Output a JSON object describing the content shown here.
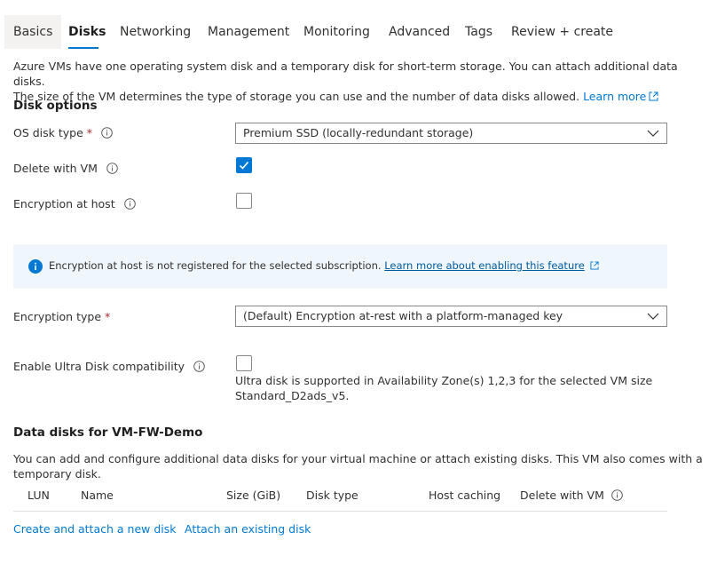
{
  "tabs": [
    {
      "label": "Basics"
    },
    {
      "label": "Disks"
    },
    {
      "label": "Networking"
    },
    {
      "label": "Management"
    },
    {
      "label": "Monitoring"
    },
    {
      "label": "Advanced"
    },
    {
      "label": "Tags"
    },
    {
      "label": "Review + create"
    }
  ],
  "active_tab": "Disks",
  "intro": {
    "line1": "Azure VMs have one operating system disk and a temporary disk for short-term storage. You can attach additional data disks.",
    "line2": "The size of the VM determines the type of storage you can use and the number of data disks allowed.",
    "learn_more": "Learn more"
  },
  "disk_options": {
    "title": "Disk options",
    "os_disk_type": {
      "label": "OS disk type",
      "required_mark": "*",
      "value": "Premium SSD (locally-redundant storage)"
    },
    "delete_with_vm": {
      "label": "Delete with VM",
      "checked": true
    },
    "encryption_at_host": {
      "label": "Encryption at host",
      "checked": false
    }
  },
  "banner": {
    "text": "Encryption at host is not registered for the selected subscription.",
    "link": "Learn more about enabling this feature"
  },
  "encryption_type": {
    "label": "Encryption type",
    "required_mark": "*",
    "value": "(Default) Encryption at-rest with a platform-managed key"
  },
  "ultra_disk": {
    "label": "Enable Ultra Disk compatibility",
    "checked": false,
    "note_line1": "Ultra disk is supported in Availability Zone(s) 1,2,3 for the selected VM size",
    "note_line2": "Standard_D2ads_v5."
  },
  "data_disks": {
    "title": "Data disks for VM-FW-Demo",
    "description_line1": "You can add and configure additional data disks for your virtual machine or attach existing disks. This VM also comes with a",
    "description_line2": "temporary disk.",
    "columns": [
      "LUN",
      "Name",
      "Size (GiB)",
      "Disk type",
      "Host caching",
      "Delete with VM"
    ],
    "create_link": "Create and attach a new disk",
    "attach_link": "Attach an existing disk"
  },
  "colors": {
    "accent": "#0078d4",
    "banner_bg": "#eff6fc",
    "required": "#a4262c"
  }
}
